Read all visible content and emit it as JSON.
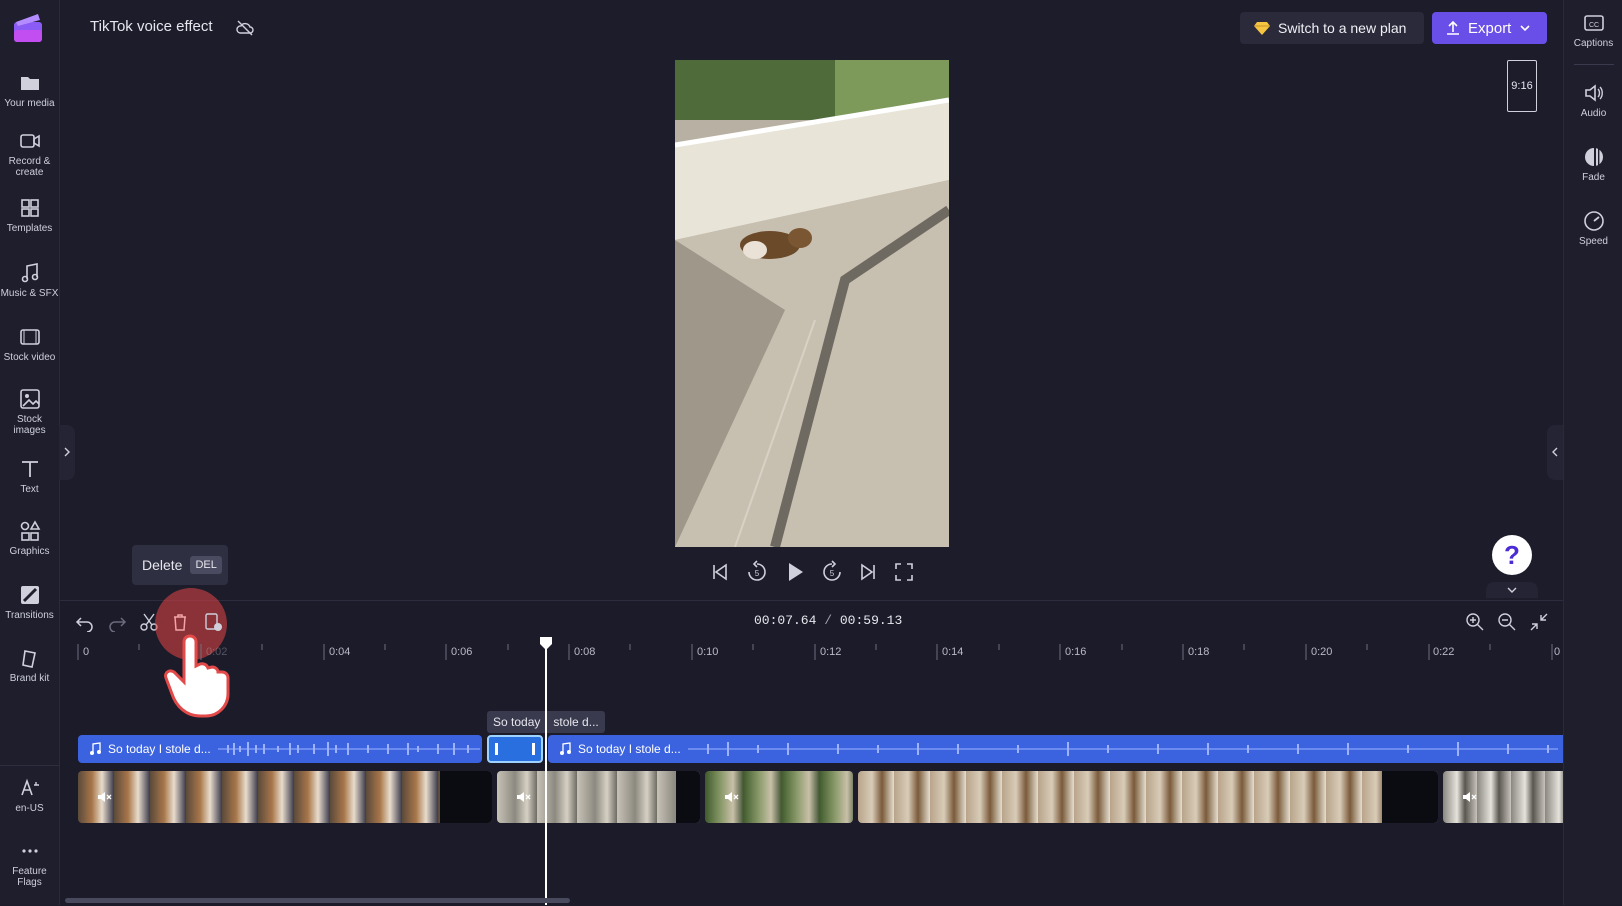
{
  "header": {
    "project_title": "TikTok voice effect",
    "switch_plan_label": "Switch to a new plan",
    "export_label": "Export",
    "aspect_ratio": "9:16"
  },
  "left_sidebar": [
    {
      "label": "Your media",
      "icon": "folder-icon"
    },
    {
      "label": "Record & create",
      "icon": "camera-icon"
    },
    {
      "label": "Templates",
      "icon": "templates-icon"
    },
    {
      "label": "Music & SFX",
      "icon": "music-icon"
    },
    {
      "label": "Stock video",
      "icon": "film-icon"
    },
    {
      "label": "Stock images",
      "icon": "image-icon"
    },
    {
      "label": "Text",
      "icon": "text-icon"
    },
    {
      "label": "Graphics",
      "icon": "shapes-icon"
    },
    {
      "label": "Transitions",
      "icon": "transition-icon"
    },
    {
      "label": "Brand kit",
      "icon": "brand-kit-icon"
    },
    {
      "label": "en-US",
      "icon": "language-icon"
    },
    {
      "label": "Feature Flags",
      "icon": "more-icon"
    }
  ],
  "right_sidebar": [
    {
      "label": "Captions",
      "icon": "captions-icon"
    },
    {
      "label": "Audio",
      "icon": "speaker-icon"
    },
    {
      "label": "Fade",
      "icon": "fade-icon"
    },
    {
      "label": "Speed",
      "icon": "speedometer-icon"
    }
  ],
  "timeline": {
    "current_time": "00:07.64",
    "separator": "/",
    "total_time": "00:59.13",
    "delete_tooltip": "Delete",
    "delete_shortcut": "DEL",
    "ticks": [
      "0",
      "0:02",
      "0:04",
      "0:06",
      "0:08",
      "0:10",
      "0:12",
      "0:14",
      "0:16",
      "0:18",
      "0:20",
      "0:22",
      "0"
    ],
    "audio_clips": [
      "So today I stole d...",
      "So today I stole d..."
    ],
    "clip_tooltip_left": "So today",
    "clip_tooltip_right": "stole d..."
  },
  "colors": {
    "accent": "#6a4ee8",
    "audio_track": "#3b63e0",
    "background": "#1c1c2b"
  }
}
